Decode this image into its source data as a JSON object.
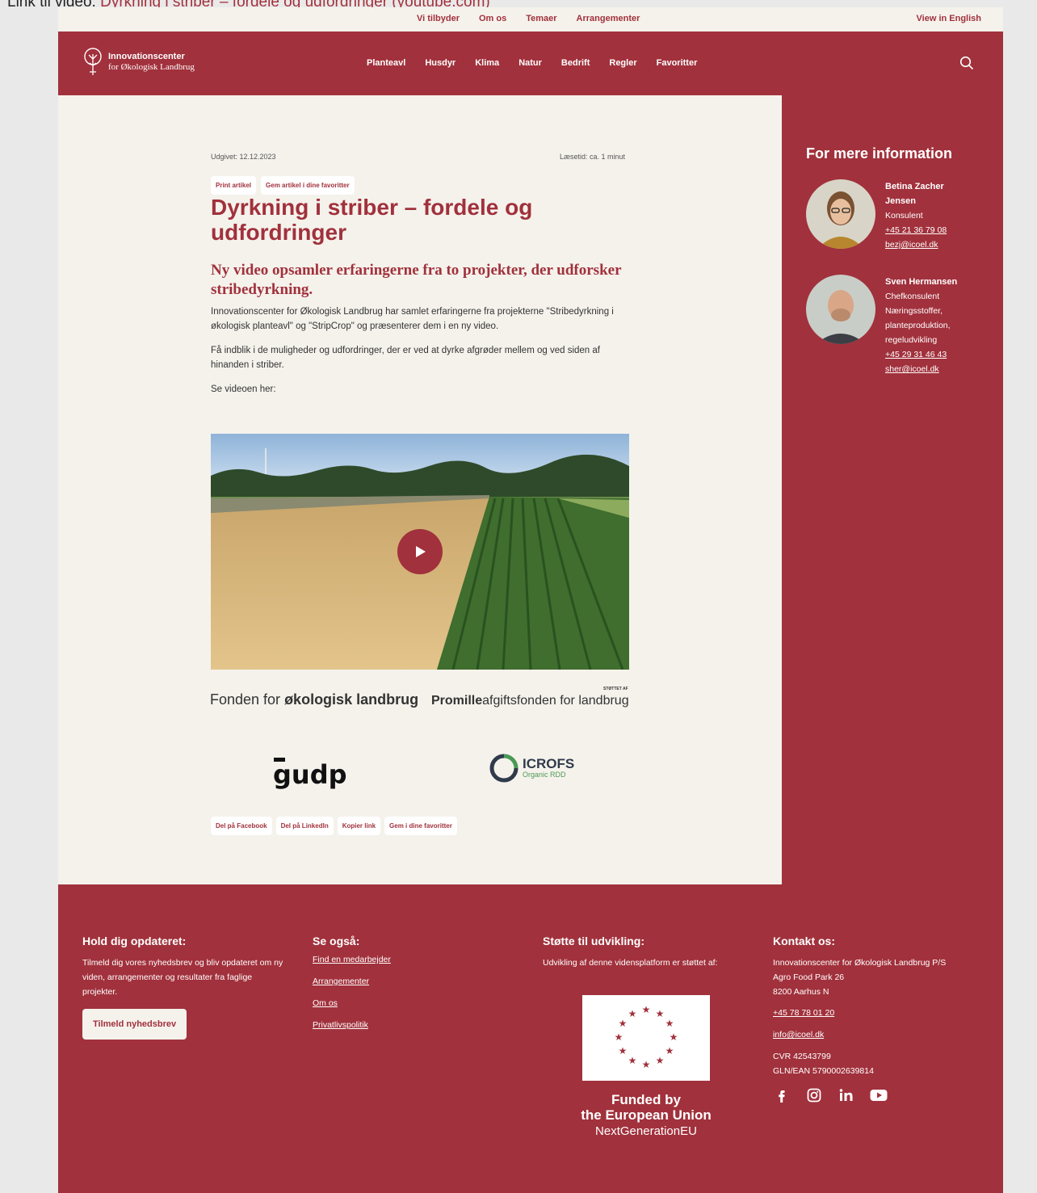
{
  "top_link": {
    "prefix": "Link til video:",
    "label": "Dyrkning i striber – fordele og udfordringer (youtube.com)"
  },
  "utility_nav": {
    "items": [
      "Vi tilbyder",
      "Om os",
      "Temaer",
      "Arrangementer"
    ],
    "lang": "View in English"
  },
  "logo": {
    "line1": "Innovationscenter",
    "line2": "for Økologisk Landbrug"
  },
  "main_nav": [
    "Planteavl",
    "Husdyr",
    "Klima",
    "Natur",
    "Bedrift",
    "Regler",
    "Favoritter"
  ],
  "article": {
    "published": "Udgivet: 12.12.2023",
    "read_time": "Læsetid: ca. 1 minut",
    "actions_top": [
      "Print artikel",
      "Gem artikel i dine favoritter"
    ],
    "title": "Dyrkning i striber – fordele og udfordringer",
    "subtitle": "Ny video opsamler erfaringerne fra to projekter, der udforsker stribedyrkning.",
    "paragraphs": [
      "Innovationscenter for Økologisk Landbrug har samlet erfaringerne fra projekterne \"Stribedyrkning i økologisk planteavl\" og \"StripCrop\" og præsenterer dem i en ny video.",
      "Få indblik i de muligheder og udfordringer, der er ved at dyrke afgrøder mellem og ved siden af hinanden i striber.",
      "Se videoen her:"
    ],
    "sponsors": {
      "tag": "STØTTET AF",
      "fonden_prefix": "Fonden for ",
      "fonden_bold": "økologisk landbrug",
      "promille_bold": "Promille",
      "promille_rest": "afgiftsfonden for landbrug",
      "gudp": "gudp",
      "icrofs_name": "ICROFS",
      "icrofs_sub": "Organic RDD"
    },
    "actions_bottom": [
      "Del på Facebook",
      "Del på LinkedIn",
      "Kopier link",
      "Gem i dine favoritter"
    ]
  },
  "sidebar": {
    "heading": "For mere information",
    "people": [
      {
        "name": "Betina Zacher Jensen",
        "role": "Konsulent",
        "extra": "",
        "phone": "+45 21 36 79 08",
        "email": "bezj@icoel.dk"
      },
      {
        "name": "Sven Hermansen",
        "role": "Chefkonsulent",
        "extra": "Næringsstoffer, planteproduktion, regeludvikling",
        "phone": "+45 29 31 46 43",
        "email": "sher@icoel.dk"
      }
    ]
  },
  "footer": {
    "newsletter": {
      "heading": "Hold dig opdateret:",
      "text": "Tilmeld dig vores nyhedsbrev og bliv opdateret om ny viden, arrangementer og resultater fra faglige projekter.",
      "button": "Tilmeld nyhedsbrev"
    },
    "see_also": {
      "heading": "Se også:",
      "links": [
        "Find en medarbejder",
        "Arrangementer",
        "Om os",
        "Privatlivspolitik"
      ]
    },
    "support": {
      "heading": "Støtte til udvikling:",
      "text": "Udvikling af denne vidensplatform er støttet af:",
      "eu_line1": "Funded by",
      "eu_line2": "the European Union",
      "eu_line3": "NextGenerationEU"
    },
    "contact": {
      "heading": "Kontakt os:",
      "company": "Innovationscenter for Økologisk Landbrug P/S",
      "street": "Agro Food Park 26",
      "city": "8200 Aarhus N",
      "phone": "+45 78 78 01 20",
      "email": "info@icoel.dk",
      "cvr": "CVR 42543799",
      "gln": "GLN/EAN 5790002639814"
    }
  },
  "colors": {
    "brand": "#a1313c",
    "cream": "#f5f2ec"
  }
}
